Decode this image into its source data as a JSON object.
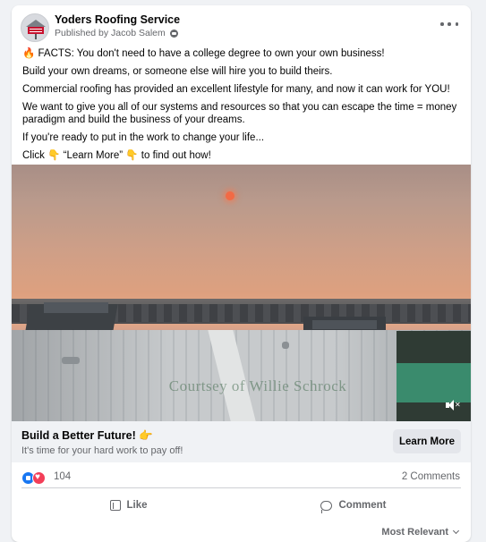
{
  "post": {
    "page_name": "Yoders Roofing Service",
    "published_by": "Published by Jacob Salem",
    "lines": [
      "🔥 FACTS: You don't need to have a college degree to own your own business!",
      "Build your own dreams, or someone else will hire you to build theirs.",
      "Commercial roofing has provided an excellent lifestyle for many, and now it can work for YOU!",
      "We want to give you all of our systems and resources so that you can escape the time = money paradigm and build the business of your dreams.",
      "If you're ready to put in the work to change your life...",
      "Click 👇 “Learn More” 👇 to find out how!"
    ]
  },
  "media": {
    "watermark": "Courtsey of Willie Schrock"
  },
  "cta": {
    "title": "Build a Better Future! 👉",
    "subtitle": "It's time for your hard work to pay off!",
    "button": "Learn More"
  },
  "engagement": {
    "reaction_count": "104",
    "comments": "2 Comments"
  },
  "actions": {
    "like": "Like",
    "comment": "Comment"
  },
  "sort": {
    "label": "Most Relevant"
  },
  "icons": {
    "logo": "yoders-logo-icon",
    "privacy": "globe-icon",
    "more": "more-options-icon",
    "mute": "mute-icon",
    "like_reaction": "like-reaction-icon",
    "love_reaction": "love-reaction-icon",
    "like_action": "thumbs-up-icon",
    "comment_action": "comment-bubble-icon",
    "sort": "chevron-down-icon"
  },
  "colors": {
    "brand_blue": "#1877f2",
    "love_red": "#f33e58",
    "secondary_text": "#65676b",
    "cta_background": "#f0f2f5"
  }
}
